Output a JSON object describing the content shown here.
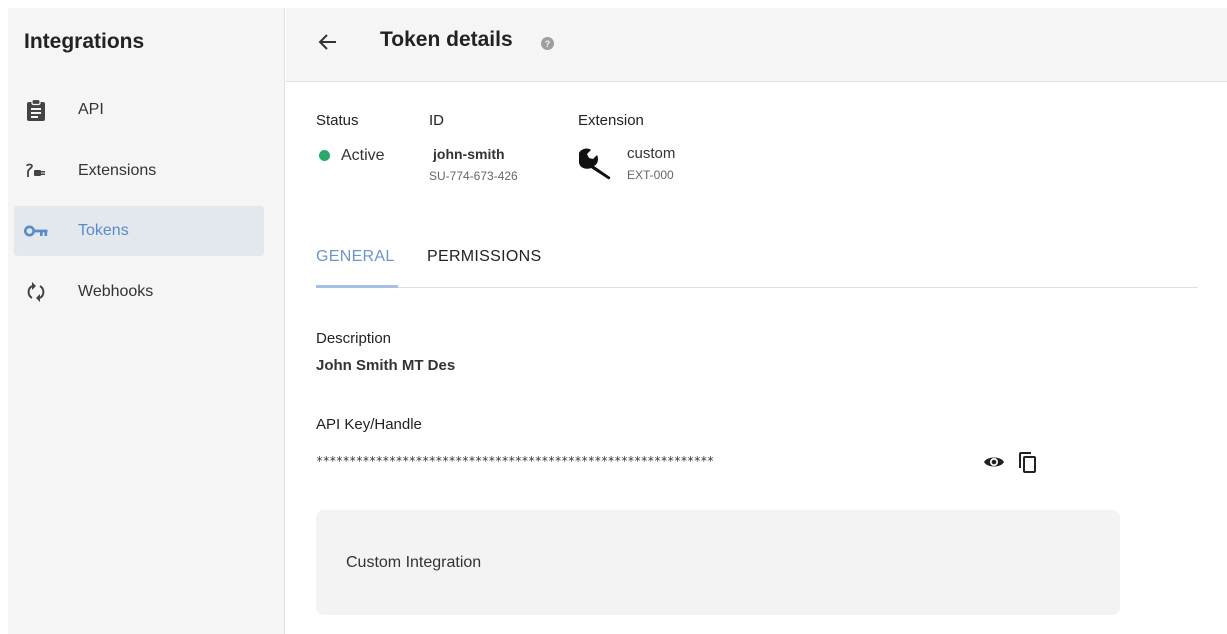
{
  "sidebar": {
    "title": "Integrations",
    "items": [
      {
        "label": "API",
        "icon": "clipboard-icon"
      },
      {
        "label": "Extensions",
        "icon": "plug-icon"
      },
      {
        "label": "Tokens",
        "icon": "key-icon"
      },
      {
        "label": "Webhooks",
        "icon": "sync-icon"
      }
    ],
    "active": "Tokens"
  },
  "header": {
    "title": "Token details",
    "back_icon": "arrow-back-icon",
    "help_icon": "help-icon"
  },
  "details": {
    "status_label": "Status",
    "status_value": "Active",
    "id_label": "ID",
    "id_name": "john-smith",
    "id_code": "SU-774-673-426",
    "extension_label": "Extension",
    "extension_name": "custom",
    "extension_code": "EXT-000"
  },
  "tabs": [
    {
      "label": "GENERAL",
      "active": true
    },
    {
      "label": "PERMISSIONS",
      "active": false
    }
  ],
  "general": {
    "description_label": "Description",
    "description_value": "John Smith MT Des",
    "api_key_label": "API Key/Handle",
    "api_key_value": "************************************************************",
    "card_text": "Custom Integration"
  },
  "colors": {
    "accent": "#6a96cf",
    "status_active": "#29a86a",
    "sidebar_bg": "#f5f5f5",
    "active_item_bg": "#e3e8ef"
  }
}
